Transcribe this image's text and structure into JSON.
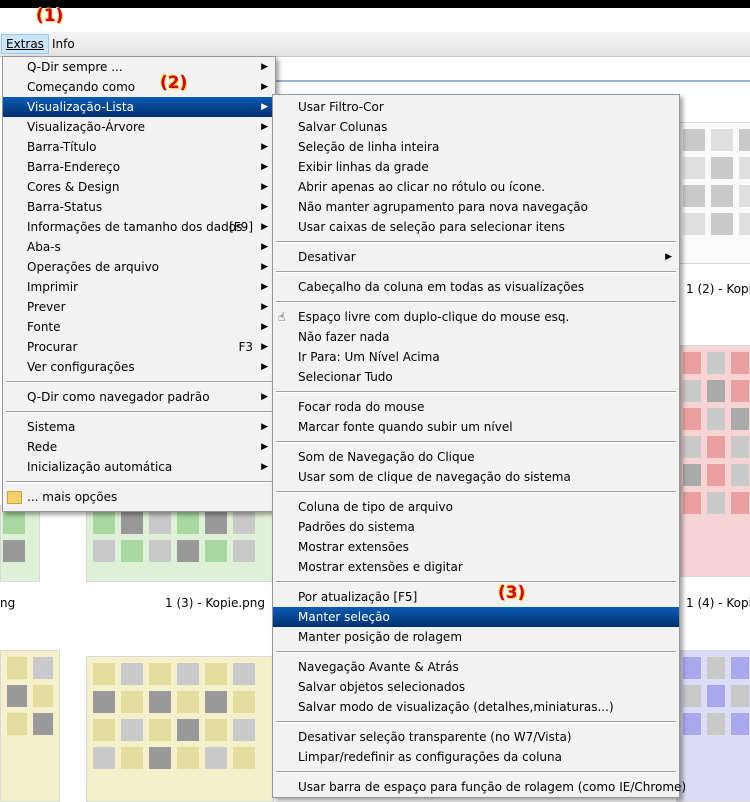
{
  "callouts": {
    "c1": "(1)",
    "c2": "(2)",
    "c3": "(3)"
  },
  "menubar": {
    "extras": "Extras",
    "info": "Info"
  },
  "background": {
    "captions": [
      "1 (2) - Kopie",
      "1 (3) - Kopie.png",
      "1 (4) - Kopie",
      "ng"
    ]
  },
  "extras_menu": {
    "items": [
      {
        "label": "Q-Dir sempre ...",
        "arrow": "▶"
      },
      {
        "label": "Começando como",
        "arrow": "▶"
      },
      {
        "label": "Visualização-Lista",
        "arrow": "▶"
      },
      {
        "label": "Visualização-Árvore",
        "arrow": "▶"
      },
      {
        "label": "Barra-Título",
        "arrow": "▶"
      },
      {
        "label": "Barra-Endereço",
        "arrow": "▶"
      },
      {
        "label": "Cores & Design",
        "arrow": "▶"
      },
      {
        "label": "Barra-Status",
        "arrow": "▶"
      },
      {
        "label": "Informações de tamanho dos dados",
        "shortcut": "[F9]",
        "arrow": "▶"
      },
      {
        "label": "Aba-s",
        "arrow": "▶"
      },
      {
        "label": "Operações de arquivo",
        "arrow": "▶"
      },
      {
        "label": "Imprimir",
        "arrow": "▶"
      },
      {
        "label": "Prever",
        "arrow": "▶"
      },
      {
        "label": "Fonte",
        "arrow": "▶"
      },
      {
        "label": "Procurar",
        "shortcut": "F3",
        "arrow": "▶"
      },
      {
        "label": "Ver configurações",
        "arrow": "▶"
      },
      {
        "label": "Q-Dir como navegador padrão",
        "arrow": "▶"
      },
      {
        "label": "Sistema",
        "arrow": "▶"
      },
      {
        "label": "Rede",
        "arrow": "▶"
      },
      {
        "label": "Inicialização automática",
        "arrow": "▶"
      },
      {
        "label": "... mais opções"
      }
    ]
  },
  "list_menu": {
    "items": [
      {
        "label": "Usar Filtro-Cor"
      },
      {
        "label": "Salvar Colunas"
      },
      {
        "label": "Seleção de linha inteira"
      },
      {
        "label": "Exibir linhas da grade"
      },
      {
        "label": "Abrir apenas ao clicar no rótulo ou ícone."
      },
      {
        "label": "Não manter agrupamento para nova navegação"
      },
      {
        "label": "Usar caixas de seleção para selecionar itens"
      },
      {
        "label": "Desativar",
        "arrow": "▶"
      },
      {
        "label": "Cabeçalho da coluna em todas as visualizações"
      },
      {
        "label": "Espaço livre com duplo-clique do mouse esq."
      },
      {
        "label": "Não fazer nada"
      },
      {
        "label": "Ir Para: Um Nível Acima"
      },
      {
        "label": "Selecionar Tudo"
      },
      {
        "label": "Focar roda do mouse"
      },
      {
        "label": "Marcar fonte quando subir um nível"
      },
      {
        "label": "Som de Navegação do Clique"
      },
      {
        "label": "Usar som de clique de navegação do sistema"
      },
      {
        "label": "Coluna de tipo de arquivo"
      },
      {
        "label": "Padrões do sistema"
      },
      {
        "label": "Mostrar extensões"
      },
      {
        "label": "Mostrar extensões e digitar"
      },
      {
        "label": "Por atualização [F5]"
      },
      {
        "label": "Manter seleção"
      },
      {
        "label": "Manter posição de rolagem"
      },
      {
        "label": "Navegação Avante & Atrás"
      },
      {
        "label": "Salvar objetos selecionados"
      },
      {
        "label": "Salvar modo de visualização (detalhes,miniaturas...)"
      },
      {
        "label": "Desativar seleção transparente (no W7/Vista)"
      },
      {
        "label": "Limpar/redefinir as configurações da coluna"
      },
      {
        "label": "Usar barra de espaço para função de rolagem (como IE/Chrome)"
      }
    ]
  },
  "colors": {
    "highlight": "#00306f",
    "callout": "#c8001e"
  },
  "icons": {
    "folder": "folder-icon",
    "hand": "hand-pointer-icon",
    "submenu": "submenu-arrow-icon"
  }
}
